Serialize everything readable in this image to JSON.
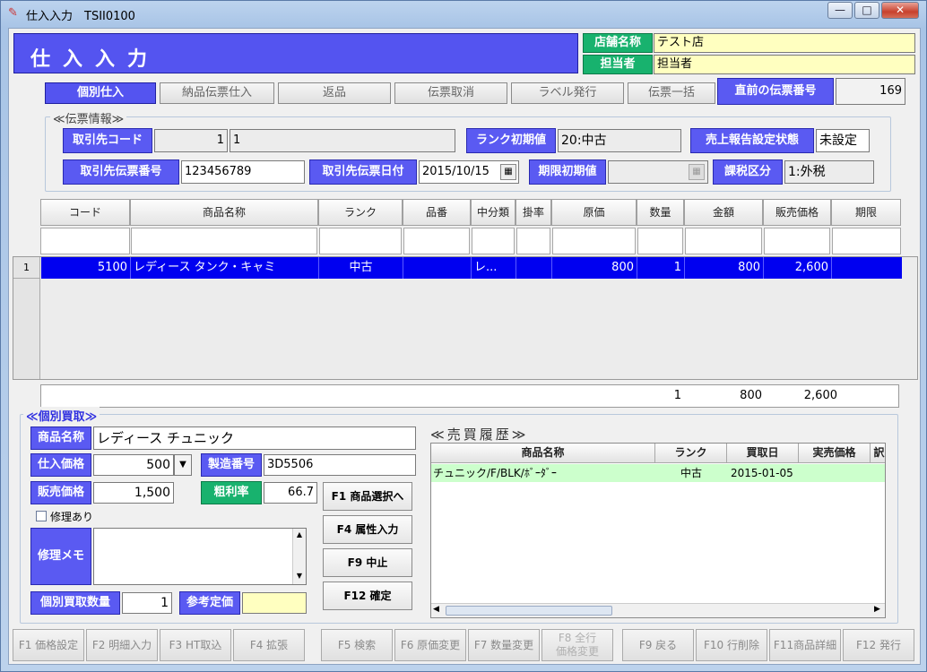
{
  "window": {
    "title": "仕入入力　TSII0100",
    "min": "—",
    "max": "□",
    "close": "✕"
  },
  "header": {
    "title": "仕入入力"
  },
  "store": {
    "name_label": "店舗名称",
    "name_value": "テスト店",
    "staff_label": "担当者",
    "staff_value": "担当者"
  },
  "tabs": [
    "個別仕入",
    "納品伝票仕入",
    "返品",
    "伝票取消",
    "ラベル発行",
    "伝票一括"
  ],
  "prev_slip": {
    "label": "直前の伝票番号",
    "value": "169"
  },
  "slip_info": {
    "title": "≪伝票情報≫",
    "supplier_code_label": "取引先コード",
    "supplier_code": "1",
    "supplier_name": "1",
    "rank_label": "ランク初期値",
    "rank_value": "20:中古",
    "sales_report_label": "売上報告設定状態",
    "sales_report_value": "未設定",
    "supplier_slip_no_label": "取引先伝票番号",
    "supplier_slip_no": "123456789",
    "supplier_slip_date_label": "取引先伝票日付",
    "supplier_slip_date": "2015/10/15",
    "expiry_label": "期限初期値",
    "expiry_value": "",
    "tax_label": "課税区分",
    "tax_value": "1:外税"
  },
  "grid": {
    "headers": [
      "コード",
      "商品名称",
      "ランク",
      "品番",
      "中分類",
      "掛率",
      "原価",
      "数量",
      "金額",
      "販売価格",
      "期限"
    ],
    "rows": [
      {
        "no": "1",
        "code": "5100",
        "name": "レディース タンク・キャミ",
        "rank": "中古",
        "part": "",
        "category": "レ...",
        "rate": "",
        "cost": "800",
        "qty": "1",
        "amount": "800",
        "price": "2,600",
        "expiry": ""
      }
    ],
    "totals": {
      "qty": "1",
      "amount": "800",
      "price": "2,600"
    }
  },
  "purchase": {
    "title": "≪個別買取≫",
    "product_label": "商品名称",
    "product_value": "レディース チュニック",
    "cost_label": "仕入価格",
    "cost_value": "500",
    "serial_label": "製造番号",
    "serial_value": "3D5506",
    "sale_label": "販売価格",
    "sale_value": "1,500",
    "margin_label": "粗利率",
    "margin_value": "66.7",
    "repair_label": "修理あり",
    "memo_label": "修理メモ",
    "qty_label": "個別買取数量",
    "qty_value": "1",
    "ref_price_label": "参考定価",
    "ref_price_value": ""
  },
  "actions": [
    "F1 商品選択へ",
    "F4 属性入力",
    "F9 中止",
    "F12 確定"
  ],
  "history": {
    "title": "≪売買履歴≫",
    "headers": [
      "商品名称",
      "ランク",
      "買取日",
      "実売価格",
      "訳"
    ],
    "rows": [
      {
        "name": "チュニック/F/BLK/ﾎﾞｰﾀﾞｰ",
        "rank": "中古",
        "date": "2015-01-05",
        "price": ""
      }
    ]
  },
  "fkeys": [
    "F1 価格設定",
    "F2 明細入力",
    "F3 HT取込",
    "F4 拡張",
    "F5 検索",
    "F6 原価変更",
    "F7 数量変更",
    "F8 全行\n価格変更",
    "F9 戻る",
    "F10 行削除",
    "F11商品詳細",
    "F12 発行"
  ],
  "colors": {
    "accent": "#5454f0",
    "green": "#18b26e",
    "selected_row": "#0000f0",
    "history_row": "#ccffcc"
  }
}
